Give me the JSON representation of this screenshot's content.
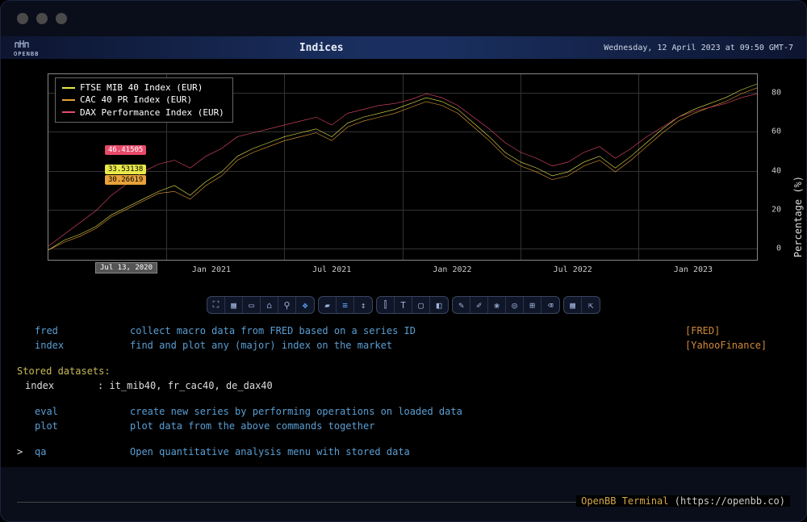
{
  "header": {
    "brand": "OPENBB",
    "title": "Indices",
    "datetime": "Wednesday, 12 April 2023 at 09:50 GMT-7"
  },
  "chart_data": {
    "type": "line",
    "ylabel": "Percentage (%)",
    "ylim": [
      -5,
      90
    ],
    "x_ticks": [
      "Jan 2021",
      "Jul 2021",
      "Jan 2022",
      "Jul 2022",
      "Jan 2023"
    ],
    "hover_x": "Jul 13, 2020",
    "hover_values": {
      "dax": 46.41505,
      "ftse": 33.53138,
      "cac": 30.26619
    },
    "series": [
      {
        "name": "FTSE MIB 40 Index (EUR)",
        "color": "#e8e84a",
        "values": [
          0,
          5,
          8,
          12,
          18,
          22,
          26,
          30,
          33,
          28,
          35,
          40,
          48,
          52,
          55,
          58,
          60,
          62,
          58,
          65,
          68,
          70,
          72,
          75,
          78,
          76,
          72,
          65,
          58,
          50,
          45,
          42,
          38,
          40,
          45,
          48,
          42,
          48,
          55,
          62,
          68,
          72,
          75,
          78,
          82,
          85
        ]
      },
      {
        "name": "CAC 40 PR Index (EUR)",
        "color": "#e8a23a",
        "values": [
          0,
          4,
          7,
          11,
          17,
          21,
          25,
          29,
          30,
          26,
          33,
          38,
          46,
          50,
          53,
          56,
          58,
          60,
          56,
          63,
          66,
          68,
          70,
          73,
          76,
          74,
          70,
          63,
          56,
          48,
          43,
          40,
          36,
          38,
          43,
          46,
          40,
          46,
          53,
          60,
          66,
          70,
          73,
          76,
          80,
          83
        ]
      },
      {
        "name": "DAX Performance Index (EUR)",
        "color": "#e84a6a",
        "values": [
          2,
          8,
          14,
          20,
          28,
          34,
          40,
          44,
          46,
          42,
          48,
          52,
          58,
          60,
          62,
          64,
          66,
          68,
          64,
          70,
          72,
          74,
          75,
          77,
          80,
          78,
          74,
          68,
          62,
          55,
          50,
          47,
          43,
          45,
          50,
          53,
          47,
          52,
          58,
          63,
          68,
          71,
          73,
          75,
          78,
          80
        ]
      }
    ]
  },
  "legend": [
    {
      "label": "FTSE MIB 40 Index (EUR)",
      "color": "#e8e84a"
    },
    {
      "label": "CAC 40 PR Index (EUR)",
      "color": "#e8a23a"
    },
    {
      "label": "DAX Performance Index (EUR)",
      "color": "#e84a6a"
    }
  ],
  "toolbar_groups": [
    [
      "expand-icon",
      "plus-icon",
      "minus-icon",
      "home-icon",
      "search-icon",
      "move-icon"
    ],
    [
      "tag-icon",
      "lines-icon",
      "ruler-icon"
    ],
    [
      "chart-icon",
      "text-icon",
      "rect-icon",
      "color-icon"
    ],
    [
      "leaf1-icon",
      "brush-icon",
      "leaf2-icon",
      "target-icon",
      "add-icon",
      "delete-icon"
    ],
    [
      "grid-icon",
      "external-icon"
    ]
  ],
  "terminal": {
    "rows": [
      {
        "cmd": "fred",
        "desc": "collect macro data from FRED based on a series ID",
        "src": "[FRED]"
      },
      {
        "cmd": "index",
        "desc": "find and plot any (major) index on the market",
        "src": "[YahooFinance]"
      }
    ],
    "stored_head": "Stored datasets:",
    "stored_line_key": "index",
    "stored_line_val": ": it_mib40, fr_cac40, de_dax40",
    "rows2": [
      {
        "cmd": "eval",
        "desc": "create new series by performing operations on loaded data"
      },
      {
        "cmd": "plot",
        "desc": "plot data from the above commands together"
      }
    ],
    "prompt_row": {
      "prompt": ">",
      "cmd": "qa",
      "desc": "Open quantitative analysis menu with stored data"
    }
  },
  "footer": {
    "brand": "OpenBB Terminal",
    "url": " (https://openbb.co) "
  }
}
